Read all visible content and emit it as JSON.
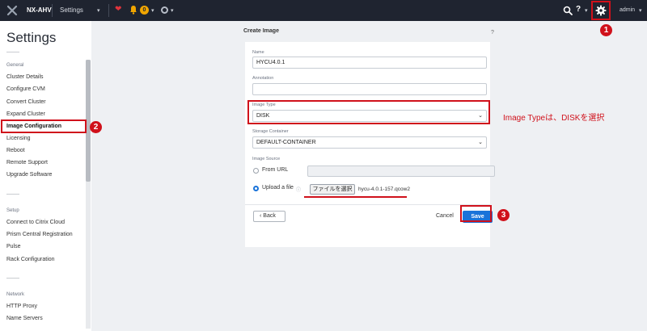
{
  "topbar": {
    "cluster_name": "NX-AHV",
    "section": "Settings",
    "alert_count": "0",
    "help_label": "?",
    "user": "admin"
  },
  "sidebar": {
    "title": "Settings",
    "groups": {
      "general": "General",
      "setup": "Setup",
      "network": "Network"
    },
    "general_items": [
      "Cluster Details",
      "Configure CVM",
      "Convert Cluster",
      "Expand Cluster",
      "Image Configuration",
      "Licensing",
      "Reboot",
      "Remote Support",
      "Upgrade Software"
    ],
    "setup_items": [
      "Connect to Citrix Cloud",
      "Prism Central Registration",
      "Pulse",
      "Rack Configuration"
    ],
    "network_items": [
      "HTTP Proxy",
      "Name Servers"
    ]
  },
  "dialog": {
    "title": "Create Image",
    "help": "?",
    "name_label": "Name",
    "name_value": "HYCU4.0.1",
    "annotation_label": "Annotation",
    "annotation_value": "",
    "image_type_label": "Image Type",
    "image_type_value": "DISK",
    "storage_label": "Storage Container",
    "storage_value": "DEFAULT-CONTAINER",
    "source_label": "Image Source",
    "from_url_label": "From URL",
    "upload_label": "Upload a file",
    "file_button": "ファイルを選択",
    "file_name": "hycu-4.0.1-157.qcow2",
    "back_label": "Back",
    "cancel_label": "Cancel",
    "save_label": "Save"
  },
  "annotations": {
    "step1": "1",
    "step2": "2",
    "step3": "3",
    "note": "Image Typeは、DISKを選択"
  },
  "colors": {
    "topbar": "#1f2430",
    "accent": "#1a73d9",
    "annotation_red": "#d0111b"
  }
}
